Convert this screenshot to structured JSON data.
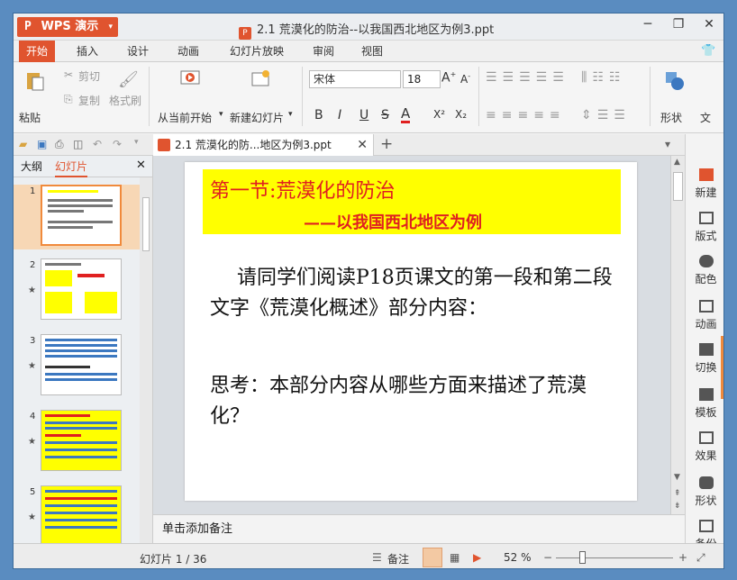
{
  "app": {
    "name": "WPS 演示",
    "logo_letter": "P",
    "window_title": "2.1   荒漠化的防治--以我国西北地区为例3.ppt"
  },
  "menu": [
    "开始",
    "插入",
    "设计",
    "动画",
    "幻灯片放映",
    "审阅",
    "视图"
  ],
  "ribbon": {
    "paste": "粘贴",
    "cut": "剪切",
    "copy": "复制",
    "format_painter": "格式刷",
    "from_current": "从当前开始",
    "new_slide": "新建幻灯片",
    "font_name": "宋体",
    "font_size": "18",
    "bold": "B",
    "italic": "I",
    "underline": "U",
    "strike": "S",
    "shape": "形状",
    "more": "文"
  },
  "doc_tab": {
    "label": "2.1    荒漠化的防...地区为例3.ppt"
  },
  "left_panel": {
    "tab_outline": "大纲",
    "tab_slides": "幻灯片",
    "slide_numbers": [
      "1",
      "2",
      "3",
      "4",
      "5"
    ]
  },
  "slide": {
    "title": "第一节:荒漠化的防治",
    "subtitle": "——以我国西北地区为例",
    "para1": "请同学们阅读P18页课文的第一段和第二段文字《荒漠化概述》部分内容：",
    "para2": "思考：本部分内容从哪些方面来描述了荒漠化？"
  },
  "notes_placeholder": "单击添加备注",
  "right_bar": [
    "新建",
    "版式",
    "配色",
    "动画",
    "切换",
    "模板",
    "效果",
    "形状",
    "备份"
  ],
  "status": {
    "slide_counter": "幻灯片 1 / 36",
    "notes": "备注",
    "zoom": "52 %"
  },
  "colors": {
    "accent": "#e0542f",
    "title_red": "#e02020",
    "highlight": "#ffff00"
  }
}
